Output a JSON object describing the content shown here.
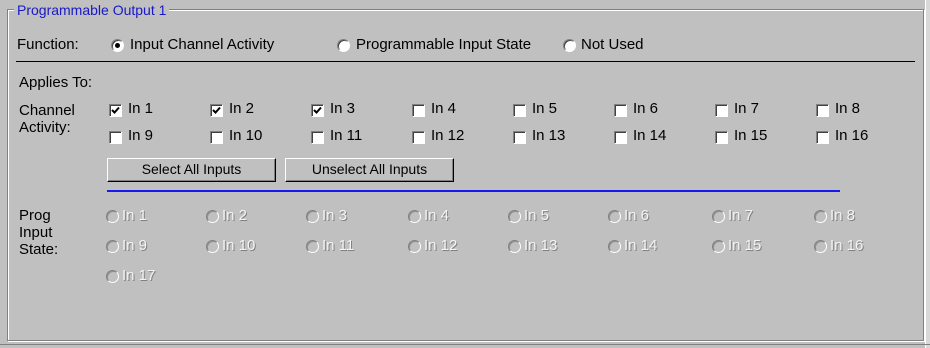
{
  "group": {
    "title": "Programmable Output 1"
  },
  "function": {
    "label": "Function:",
    "options": [
      {
        "label": "Input Channel Activity",
        "selected": true
      },
      {
        "label": "Programmable Input State",
        "selected": false
      },
      {
        "label": "Not Used",
        "selected": false
      }
    ]
  },
  "applies_to": {
    "label": "Applies To:"
  },
  "channel_activity": {
    "label_line1": "Channel",
    "label_line2": "Activity:",
    "inputs": [
      {
        "label": "In 1",
        "checked": true
      },
      {
        "label": "In 2",
        "checked": true
      },
      {
        "label": "In 3",
        "checked": true
      },
      {
        "label": "In 4",
        "checked": false
      },
      {
        "label": "In 5",
        "checked": false
      },
      {
        "label": "In 6",
        "checked": false
      },
      {
        "label": "In 7",
        "checked": false
      },
      {
        "label": "In 8",
        "checked": false
      },
      {
        "label": "In 9",
        "checked": false
      },
      {
        "label": "In 10",
        "checked": false
      },
      {
        "label": "In 11",
        "checked": false
      },
      {
        "label": "In 12",
        "checked": false
      },
      {
        "label": "In 13",
        "checked": false
      },
      {
        "label": "In 14",
        "checked": false
      },
      {
        "label": "In 15",
        "checked": false
      },
      {
        "label": "In 16",
        "checked": false
      }
    ],
    "select_all_label": "Select All Inputs",
    "unselect_all_label": "Unselect All Inputs"
  },
  "prog_input_state": {
    "label_line1": "Prog",
    "label_line2": "Input",
    "label_line3": "State:",
    "inputs": [
      {
        "label": "In 1"
      },
      {
        "label": "In 2"
      },
      {
        "label": "In 3"
      },
      {
        "label": "In 4"
      },
      {
        "label": "In 5"
      },
      {
        "label": "In 6"
      },
      {
        "label": "In 7"
      },
      {
        "label": "In 8"
      },
      {
        "label": "In 9"
      },
      {
        "label": "In 10"
      },
      {
        "label": "In 11"
      },
      {
        "label": "In 12"
      },
      {
        "label": "In 13"
      },
      {
        "label": "In 14"
      },
      {
        "label": "In 15"
      },
      {
        "label": "In 16"
      },
      {
        "label": "In 17"
      }
    ]
  },
  "colors": {
    "title": "#1818c8",
    "separator": "#1818f0",
    "background": "#c0c0c0"
  }
}
